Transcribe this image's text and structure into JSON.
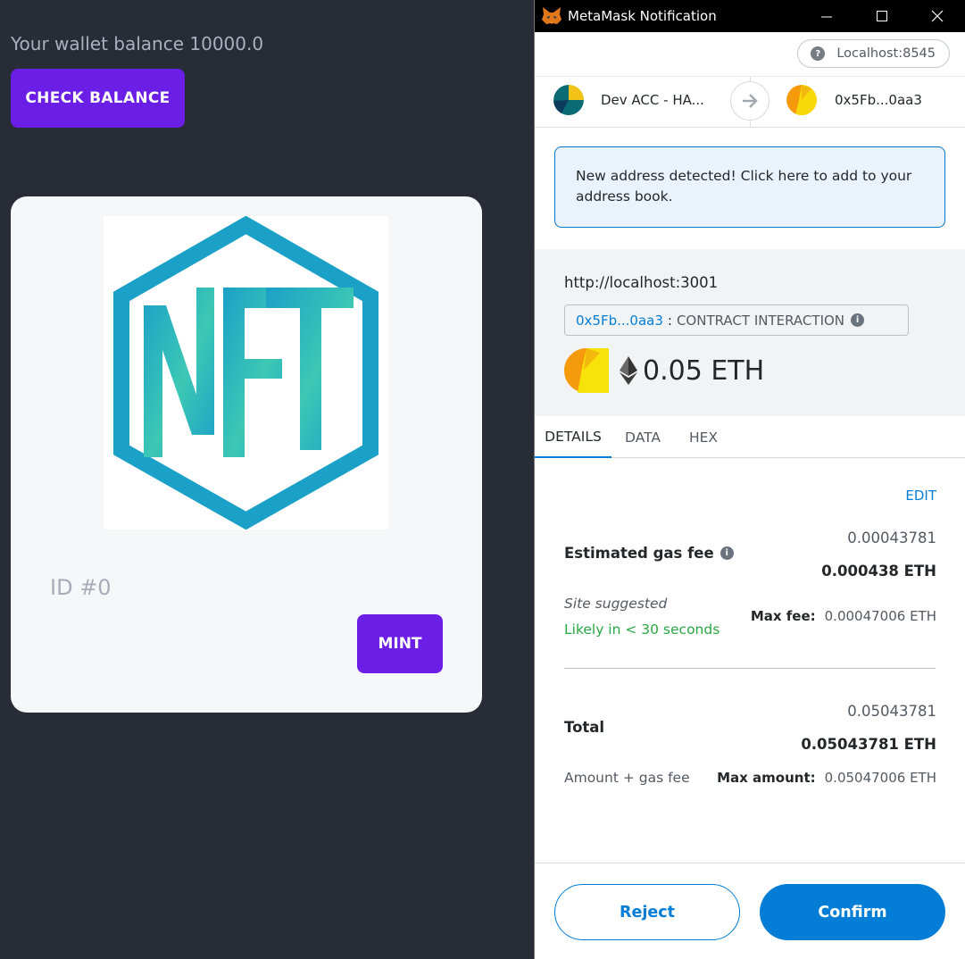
{
  "dapp": {
    "balance_text": "Your wallet balance 10000.0",
    "check_balance_label": "CHECK BALANCE",
    "nft_card": {
      "image_alt": "NFT",
      "id_label": "ID #0",
      "mint_label": "MINT"
    }
  },
  "metamask": {
    "window_title": "MetaMask Notification",
    "network": "Localhost:8545",
    "from_account": "Dev ACC - HA...",
    "to_account": "0x5Fb...0aa3",
    "alert": "New address detected! Click here to add to your address book.",
    "origin": "http://localhost:3001",
    "method": {
      "address": "0x5Fb...0aa3",
      "separator": ":",
      "label": "CONTRACT INTERACTION"
    },
    "value": "0.05 ETH",
    "tabs": [
      "DETAILS",
      "DATA",
      "HEX"
    ],
    "edit_label": "EDIT",
    "gas": {
      "label": "Estimated gas fee",
      "value": "0.00043781",
      "value_eth": "0.000438 ETH",
      "site_suggested": "Site suggested",
      "likely": "Likely in < 30 seconds",
      "max_fee_label": "Max fee:",
      "max_fee_value": "0.00047006 ETH"
    },
    "total": {
      "label": "Total",
      "value": "0.05043781",
      "value_eth": "0.05043781 ETH",
      "sub_label": "Amount + gas fee",
      "max_amount_label": "Max amount:",
      "max_amount_value": "0.05047006 ETH"
    },
    "reject_label": "Reject",
    "confirm_label": "Confirm"
  },
  "colors": {
    "background": "#282c37",
    "accent_purple": "#6a1ee6",
    "metamask_blue": "#037dd6",
    "success_green": "#28a745"
  }
}
